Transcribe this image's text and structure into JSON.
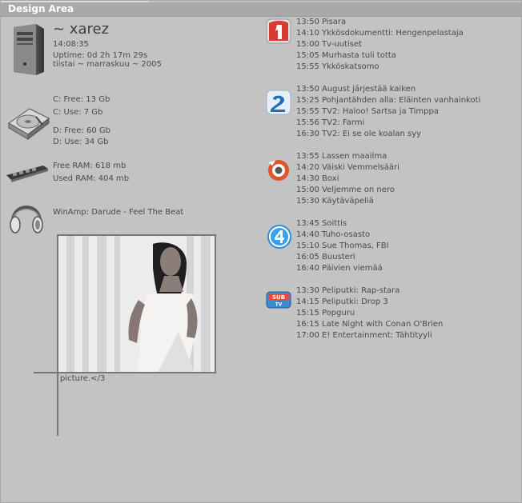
{
  "window": {
    "title": "Design Area"
  },
  "system": {
    "username": "~ xarez",
    "time": "14:08:35",
    "uptime": "Uptime: 0d 2h 17m 29s",
    "date": "tiistai ~ marraskuu ~ 2005"
  },
  "drives": {
    "c_free": "C: Free: 13 Gb",
    "c_use": "C: Use: 7 Gb",
    "d_free": "D: Free: 60 Gb",
    "d_use": "D: Use: 34 Gb"
  },
  "ram": {
    "free": "Free RAM: 618 mb",
    "used": "Used RAM: 404 mb"
  },
  "winamp": {
    "now_playing": "WinAmp: Darude - Feel The Beat"
  },
  "picture": {
    "caption": "picture.</3"
  },
  "channels": [
    {
      "icon": "channel-1-logo-icon",
      "color": "#d9362f",
      "programs": [
        "13:50 Pisara",
        "14:10 Ykkösdokumentti: Hengenpelastaja",
        "15:00 Tv-uutiset",
        "15:05 Murhasta tuli totta",
        "15:55 Ykköskatsomo"
      ]
    },
    {
      "icon": "channel-2-logo-icon",
      "color": "#1e6fc0",
      "programs": [
        "13:50 August järjestää kaiken",
        "15:25 Pohjantähden alla: Eläinten vanhainkoti",
        "15:55 TV2: Haloo! Sartsa ja Timppa",
        "15:56 TV2: Farmi",
        "16:30 TV2: Ei se ole koalan syy"
      ]
    },
    {
      "icon": "mtv3-logo-icon",
      "color": "#e0522a",
      "programs": [
        "13:55 Lassen maailma",
        "14:20 Väiski Vemmelsääri",
        "14:30 Boxi",
        "15:00 Veljemme on nero",
        "15:30 Käytäväpeliä"
      ]
    },
    {
      "icon": "nelonen-logo-icon",
      "color": "#2a8fd8",
      "programs": [
        "13:45 Soittis",
        "14:40 Tuho-osasto",
        "15:10 Sue Thomas, FBI",
        "16:05 Buusteri",
        "16:40 Päivien viemää"
      ]
    },
    {
      "icon": "subtv-logo-icon",
      "color": "#2f7fc8",
      "programs": [
        "13:30 Peliputki: Rap-stara",
        "14:15 Peliputki: Drop 3",
        "15:15 Popguru",
        "16:15 Late Night with Conan O'Brien",
        "17:00 E! Entertainment: Tähtityyli"
      ]
    }
  ]
}
